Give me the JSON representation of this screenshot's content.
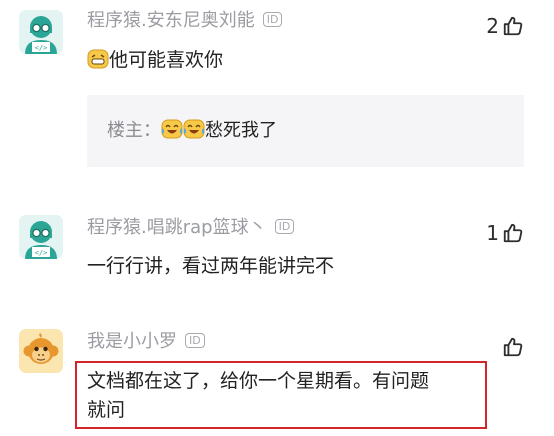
{
  "comments": [
    {
      "username": "程序猿.安东尼奥刘能",
      "badge": "ID",
      "likes": "2",
      "text": "他可能喜欢你",
      "avatar_icon": "coder-avatar-icon",
      "reply": {
        "author": "楼主：",
        "text": "愁死我了"
      }
    },
    {
      "username": "程序猿.唱跳rap篮球丶",
      "badge": "ID",
      "likes": "1",
      "text": "一行行讲，看过两年能讲完不",
      "avatar_icon": "coder-avatar-icon"
    },
    {
      "username": "我是小小罗",
      "badge": "ID",
      "likes": "",
      "text_line1": "文档都在这了，给你一个星期看。有问题",
      "text_line2": "就问",
      "avatar_icon": "monkey-avatar-icon"
    }
  ],
  "colors": {
    "highlight": "#d3262b",
    "username": "#9a9ca2",
    "reply_bg": "#f5f5f7"
  }
}
